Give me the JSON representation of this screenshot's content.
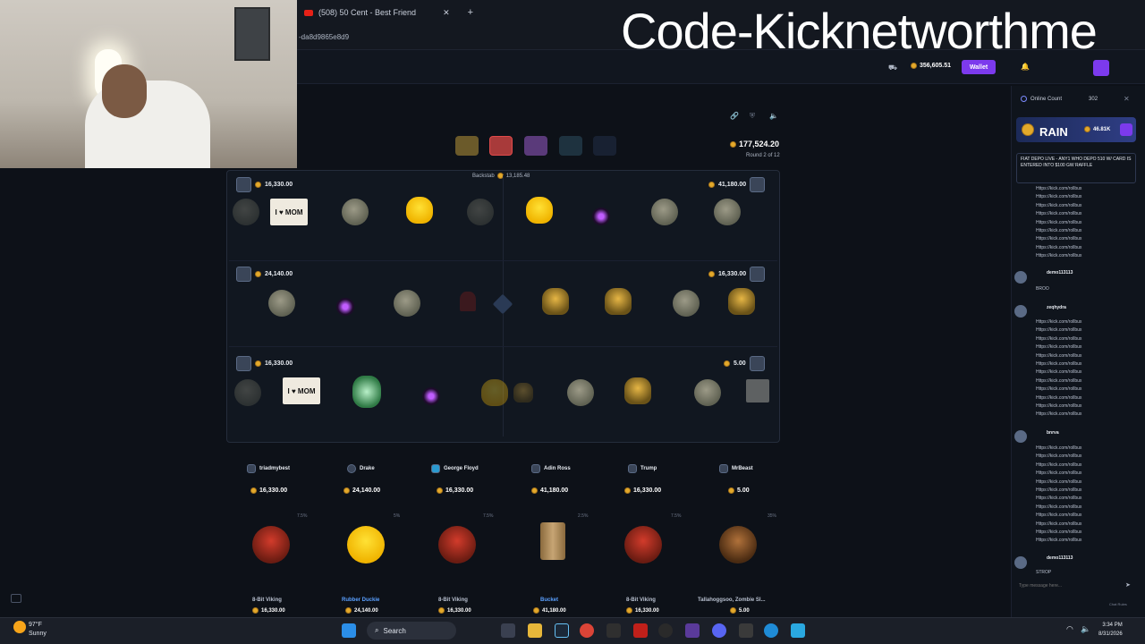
{
  "browser": {
    "tab_title": "(508) 50 Cent - Best Friend",
    "url_fragment": "-da8d9865e8d9",
    "overlay_title": "Code-Kicknetworthme"
  },
  "header": {
    "balance": "356,605.51",
    "wallet_label": "Wallet"
  },
  "battle": {
    "total": "177,524.20",
    "round": "Round 2 of 12",
    "backtab_label": "Backstab",
    "backtab_value": "13,185.48",
    "rows": [
      {
        "left_value": "16,330.00",
        "right_value": "41,180.00"
      },
      {
        "left_value": "24,140.00",
        "right_value": "16,330.00"
      },
      {
        "left_value": "16,330.00",
        "right_value": "5.00"
      }
    ],
    "mom_text": "I ♥ MOM"
  },
  "players": [
    {
      "name": "triadmybest",
      "value": "16,330.00"
    },
    {
      "name": "Drake",
      "value": "24,140.00"
    },
    {
      "name": "George Floyd",
      "value": "16,330.00"
    },
    {
      "name": "Adin Ross",
      "value": "41,180.00"
    },
    {
      "name": "Trump",
      "value": "16,330.00"
    },
    {
      "name": "MrBeast",
      "value": "5.00"
    }
  ],
  "prizes": [
    {
      "pct": "7.5%",
      "name": "8-Bit Viking",
      "value": "16,330.00",
      "color": "#cfd6e4"
    },
    {
      "pct": "5%",
      "name": "Rubber Duckie",
      "value": "24,140.00",
      "color": "#5aa0ff"
    },
    {
      "pct": "7.5%",
      "name": "8-Bit Viking",
      "value": "16,330.00",
      "color": "#cfd6e4"
    },
    {
      "pct": "2.5%",
      "name": "Bucket",
      "value": "41,180.00",
      "color": "#5aa0ff"
    },
    {
      "pct": "7.5%",
      "name": "8-Bit Viking",
      "value": "16,330.00",
      "color": "#cfd6e4"
    },
    {
      "pct": "35%",
      "name": "Tallahoggsoo, Zombie Sl...",
      "value": "5.00",
      "color": "#cfd6e4"
    }
  ],
  "chat": {
    "online_label": "Online Count",
    "online_count": "302",
    "rain_label": "RAIN",
    "rain_amount": "46.81K",
    "notice": "FIAT DEPO LIVE - ANY1 WHO DEPO 510 W/ CARD IS ENTERED INTO $100 GW RAFFLE",
    "spam": "Https://kick.com/rollbux",
    "users": [
      "demo113113",
      "zeqhydra",
      "bnrva",
      "demo113113"
    ],
    "reply_broo": "BROO",
    "reply_stop": "STROP",
    "input_placeholder": "Type message here...",
    "rules_label": "Chat Rules"
  },
  "taskbar": {
    "temp": "97°F",
    "condition": "Sunny",
    "search_label": "Search",
    "time": "3:34 PM",
    "date": "8/31/2026"
  }
}
